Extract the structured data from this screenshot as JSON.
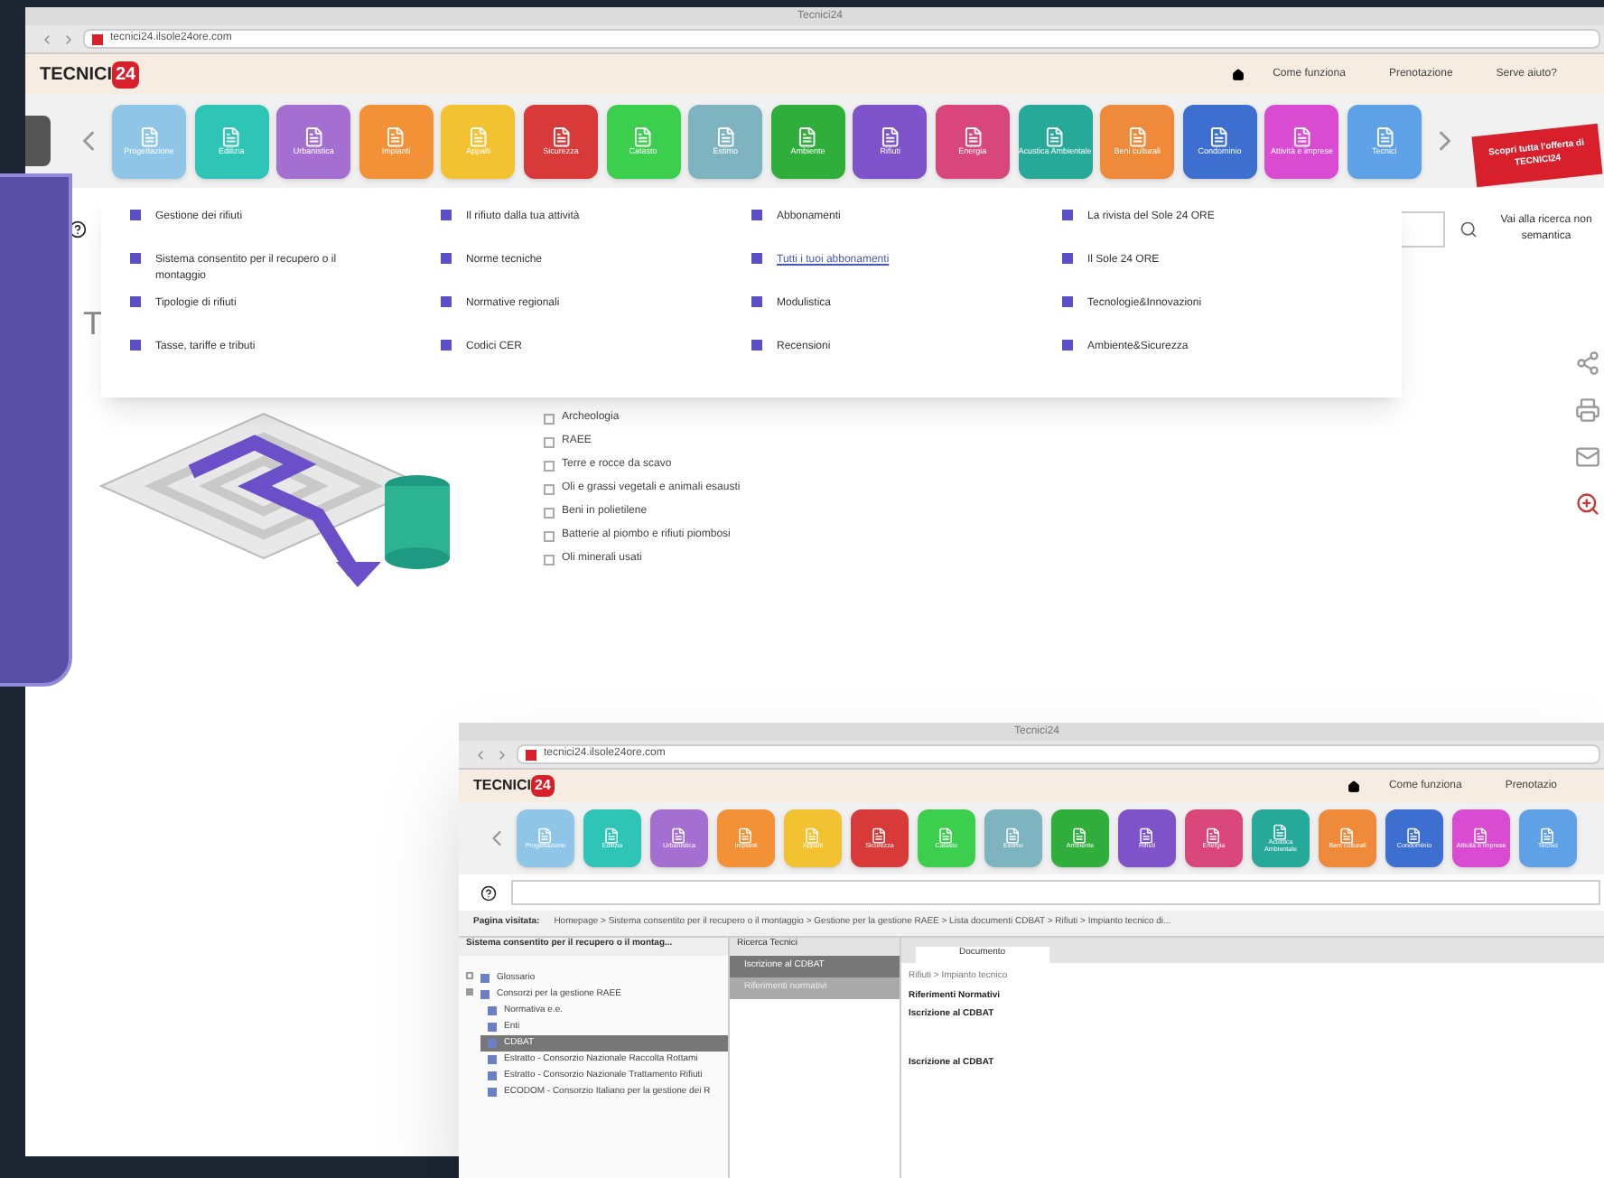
{
  "main_window": {
    "title": "Tecnici24",
    "url": "tecnici24.ilsole24ore.com",
    "logo": {
      "text": "TECNICI",
      "badge": "24"
    },
    "nav_links": [
      "Come funziona",
      "Prenotazione",
      "Serve aiuto?"
    ],
    "tiles": [
      {
        "label": "Progettazione",
        "color": "#8fc6e8"
      },
      {
        "label": "Edilizia",
        "color": "#2ec4b6"
      },
      {
        "label": "Urbanistica",
        "color": "#a56fd1"
      },
      {
        "label": "Impianti",
        "color": "#f39136"
      },
      {
        "label": "Appalti",
        "color": "#f2c230"
      },
      {
        "label": "Sicurezza",
        "color": "#d83a3a"
      },
      {
        "label": "Catasto",
        "color": "#3ccf4e"
      },
      {
        "label": "Estimo",
        "color": "#7eb3c0"
      },
      {
        "label": "Ambiente",
        "color": "#2fae3c"
      },
      {
        "label": "Rifiuti",
        "color": "#7e52c8"
      },
      {
        "label": "Energia",
        "color": "#d9477a"
      },
      {
        "label": "Acustica Ambientale",
        "color": "#27a99a"
      },
      {
        "label": "Beni culturali",
        "color": "#ee8a3a"
      },
      {
        "label": "Condominio",
        "color": "#3c6fcf"
      },
      {
        "label": "Attività e imprese",
        "color": "#d94bd1"
      },
      {
        "label": "Tecnici",
        "color": "#5ea1e6"
      }
    ],
    "promo_banner": "Scopri tutta l'offerta di TECNICI24",
    "menu_items": [
      {
        "label": "Gestione dei rifiuti",
        "kind": "plain"
      },
      {
        "label": "Il rifiuto dalla tua attività",
        "kind": "plain"
      },
      {
        "label": "Abbonamenti",
        "kind": "plain"
      },
      {
        "label": "La rivista del Sole 24 ORE",
        "kind": "plain"
      },
      {
        "label": "Sistema consentito per il recupero o il montaggio",
        "kind": "plain"
      },
      {
        "label": "Norme tecniche",
        "kind": "plain"
      },
      {
        "label": "Tutti i tuoi abbonamenti",
        "kind": "link"
      },
      {
        "label": "Il Sole 24 ORE",
        "kind": "plain"
      },
      {
        "label": "Tipologie di rifiuti",
        "kind": "plain"
      },
      {
        "label": "Normative regionali",
        "kind": "plain"
      },
      {
        "label": "Modulistica",
        "kind": "plain"
      },
      {
        "label": "Tecnologie&Innovazioni",
        "kind": "plain"
      },
      {
        "label": "Tasse, tariffe e tributi",
        "kind": "plain"
      },
      {
        "label": "Codici CER",
        "kind": "plain"
      },
      {
        "label": "Recensioni",
        "kind": "plain"
      },
      {
        "label": "Ambiente&Sicurezza",
        "kind": "plain"
      }
    ],
    "semantic_link": "Vai alla ricerca non semantica",
    "page_title": "T",
    "checklist": [
      {
        "label": "Archeologia",
        "checked": false
      },
      {
        "label": "RAEE",
        "checked": false
      },
      {
        "label": "Terre e rocce da scavo",
        "checked": false
      },
      {
        "label": "Oli e grassi vegetali e animali esausti",
        "checked": false
      },
      {
        "label": "Beni in polietilene",
        "checked": false
      },
      {
        "label": "Batterie al piombo e rifiuti piombosi",
        "checked": false
      },
      {
        "label": "Oli minerali usati",
        "checked": false
      }
    ]
  },
  "second_window": {
    "title": "Tecnici24",
    "url": "tecnici24.ilsole24ore.com",
    "logo": {
      "text": "TECNICI",
      "badge": "24"
    },
    "nav_links": [
      "Come funziona",
      "Prenotazio"
    ],
    "tiles": [
      {
        "label": "Progettazione",
        "color": "#8fc6e8"
      },
      {
        "label": "Edilizia",
        "color": "#2ec4b6"
      },
      {
        "label": "Urbanistica",
        "color": "#a56fd1"
      },
      {
        "label": "Impianti",
        "color": "#f39136"
      },
      {
        "label": "Appalti",
        "color": "#f2c230"
      },
      {
        "label": "Sicurezza",
        "color": "#d83a3a"
      },
      {
        "label": "Catasto",
        "color": "#3ccf4e"
      },
      {
        "label": "Estimo",
        "color": "#7eb3c0"
      },
      {
        "label": "Ambiente",
        "color": "#2fae3c"
      },
      {
        "label": "Rifiuti",
        "color": "#7e52c8"
      },
      {
        "label": "Energia",
        "color": "#d9477a"
      },
      {
        "label": "Acustica Ambientale",
        "color": "#27a99a"
      },
      {
        "label": "Beni culturali",
        "color": "#ee8a3a"
      },
      {
        "label": "Condominio",
        "color": "#3c6fcf"
      },
      {
        "label": "Attività e imprese",
        "color": "#d94bd1"
      },
      {
        "label": "Tecnici",
        "color": "#5ea1e6"
      }
    ],
    "breadcrumb_label": "Pagina visitata:",
    "breadcrumb": "Homepage > Sistema consentito per il recupero o il montaggio > Gestione per la gestione RAEE > Lista documenti CDBAT > Rifiuti > Impianto tecnico di...",
    "left_panel_title": "Sistema consentito per il recupero o il montag...",
    "tree": [
      {
        "label": "Glossario",
        "expanded": false,
        "selected": false
      },
      {
        "label": "Consorzi per la gestione RAEE",
        "expanded": true,
        "selected": false,
        "children": [
          {
            "label": "Normativa e.e.",
            "selected": false
          },
          {
            "label": "Enti",
            "selected": false
          },
          {
            "label": "CDBAT",
            "selected": true
          },
          {
            "label": "Estratto - Consorzio Nazionale Raccolta Rottami",
            "selected": false
          },
          {
            "label": "Estratto - Consorzio Nazionale Trattamento Rifiuti",
            "selected": false
          },
          {
            "label": "ECODOM - Consorzio Italiano per la gestione dei R",
            "selected": false
          }
        ]
      }
    ],
    "middle_tab": "Ricerca Tecnici",
    "middle_items": [
      {
        "label": "Iscrizione al CDBAT",
        "selected": true
      },
      {
        "label": "Riferimenti normativi",
        "selected": false
      }
    ],
    "document_tab": "Documento",
    "document_lines": [
      {
        "text": "Rifiuti > Impianto tecnico",
        "kind": "path"
      },
      {
        "text": "Riferimenti Normativi",
        "kind": "heading"
      },
      {
        "text": "Iscrizione al CDBAT",
        "kind": "heading"
      },
      {
        "text": "Iscrizione al CDBAT",
        "kind": "spaced"
      }
    ]
  }
}
